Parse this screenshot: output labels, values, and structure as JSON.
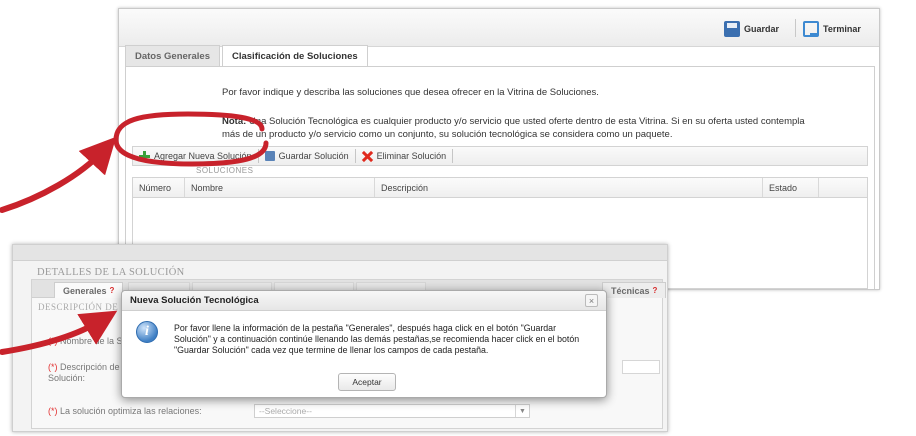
{
  "top": {
    "toolbar": {
      "save_label": "Guardar",
      "finish_label": "Terminar"
    },
    "tabs": [
      {
        "label": "Datos Generales",
        "active": false
      },
      {
        "label": "Clasificación de Soluciones",
        "active": true
      }
    ],
    "intro": "Por favor indique y describa las soluciones que desea ofrecer en la Vitrina de Soluciones.",
    "note_label": "Nota:",
    "note_text": "Una Solución Tecnológica es cualquier producto y/o servicio que usted oferte dentro de esta Vitrina. Si en su oferta usted contempla más de un producto y/o servicio como un conjunto, su solución tecnológica se considera como un paquete.",
    "solutions_toolbar": {
      "add_label": "Agregar Nueva Solución",
      "save_label": "Guardar Solución",
      "delete_label": "Eliminar Solución"
    },
    "solutions_header": "SOLUCIONES",
    "grid_columns": [
      "Número",
      "Nombre",
      "Descripción",
      "Estado",
      ""
    ]
  },
  "bottom": {
    "section_title": "DETALLES DE LA SOLUCIÓN",
    "tab_generales": "Generales",
    "tab_required_mark": "?",
    "tab_tecnicas": "Técnicas",
    "desc_label": "DESCRIPCIÓN DE LA SOLUCIÓN",
    "required_mark": "(*)",
    "field_name": "Nombre de la Solución:",
    "field_description_1": "Descripción de la",
    "field_description_2": "Solución:",
    "field_optimiza": "La solución optimiza las relaciones:",
    "select_placeholder": "--Seleccione--"
  },
  "dialog": {
    "title": "Nueva Solución Tecnológica",
    "message": "Por favor llene la información de la pestaña \"Generales\", después haga click en el botón \"Guardar Solución\" y a continuación continúe llenando las demás pestañas,se recomienda hacer click en el botón \"Guardar Solución\" cada vez que termine de llenar los campos de cada pestaña.",
    "accept_label": "Aceptar",
    "close_glyph": "×",
    "info_glyph": "i"
  },
  "colors": {
    "annotation": "#c8222b",
    "add_green": "#3aa13a",
    "delete_red": "#e02a1e",
    "required": "#e23232"
  }
}
